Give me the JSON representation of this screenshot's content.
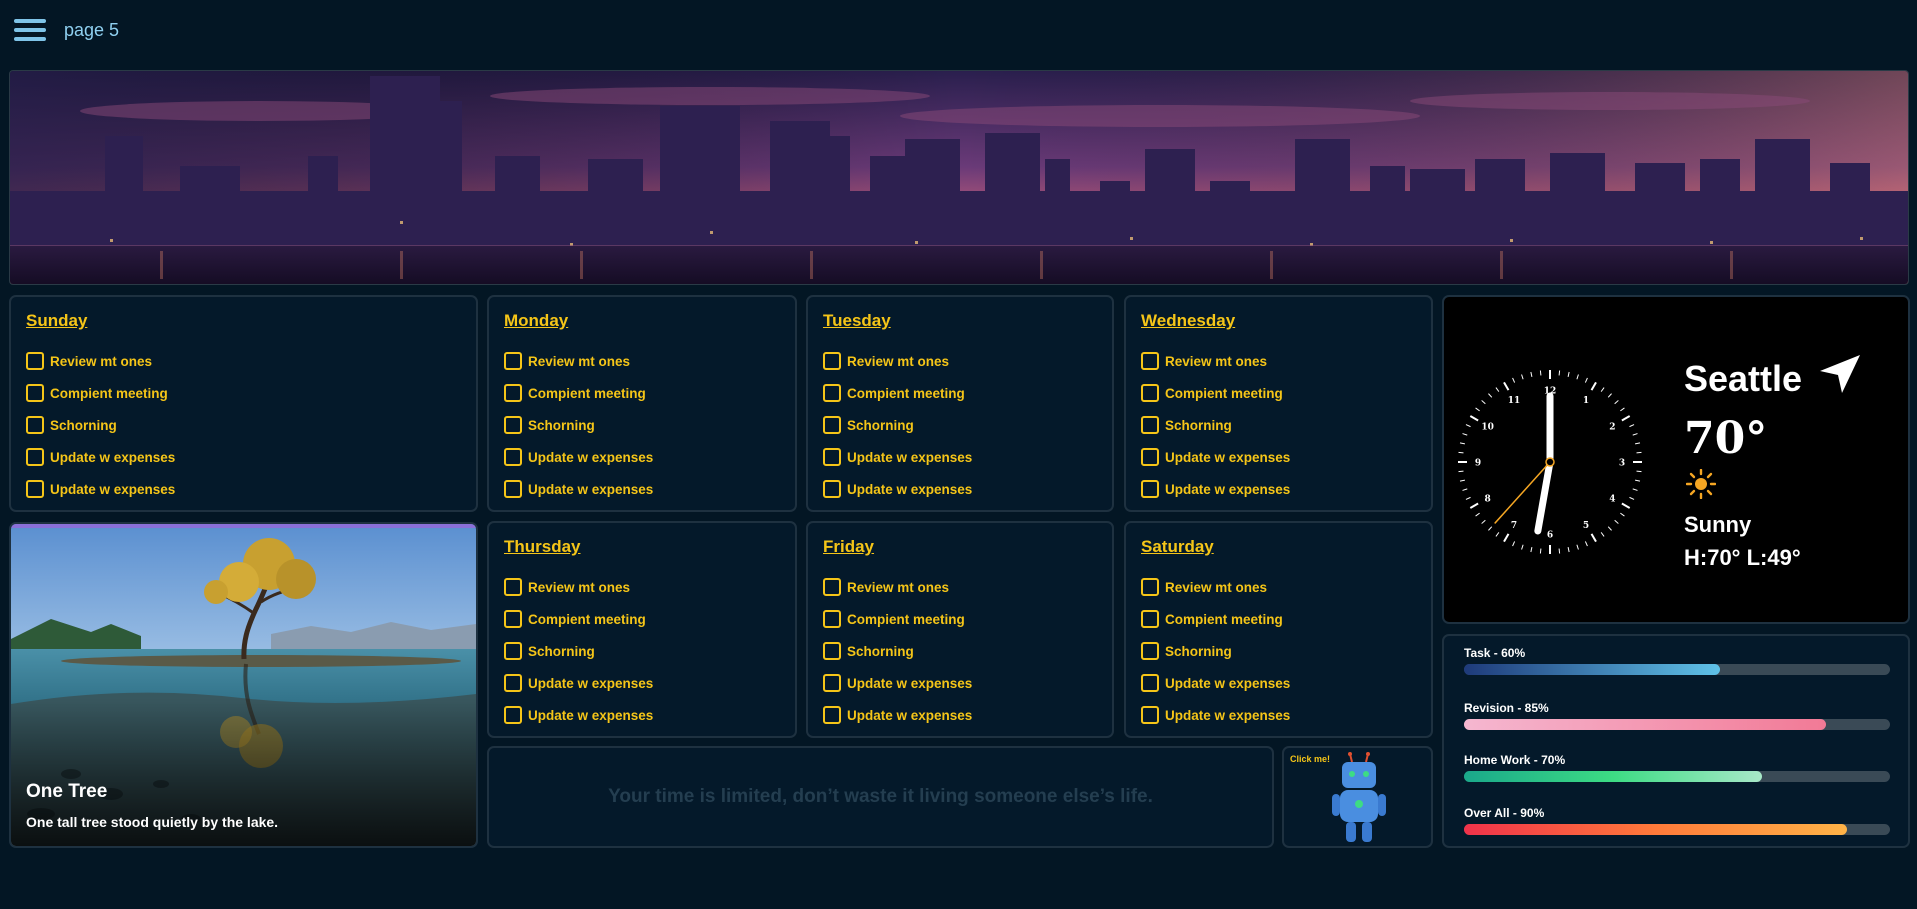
{
  "header": {
    "page_title": "page 5"
  },
  "days": [
    {
      "name": "Sunday",
      "tasks": [
        "Review mt ones",
        "Compient meeting",
        "Schorning",
        "Update w expenses",
        "Update w expenses"
      ]
    },
    {
      "name": "Monday",
      "tasks": [
        "Review mt ones",
        "Compient meeting",
        "Schorning",
        "Update w expenses",
        "Update w expenses"
      ]
    },
    {
      "name": "Tuesday",
      "tasks": [
        "Review mt ones",
        "Compient meeting",
        "Schorning",
        "Update w expenses",
        "Update w expenses"
      ]
    },
    {
      "name": "Wednesday",
      "tasks": [
        "Review mt ones",
        "Compient meeting",
        "Schorning",
        "Update w expenses",
        "Update w expenses"
      ]
    },
    {
      "name": "Thursday",
      "tasks": [
        "Review mt ones",
        "Compient meeting",
        "Schorning",
        "Update w expenses",
        "Update w expenses"
      ]
    },
    {
      "name": "Friday",
      "tasks": [
        "Review mt ones",
        "Compient meeting",
        "Schorning",
        "Update w expenses",
        "Update w expenses"
      ]
    },
    {
      "name": "Saturday",
      "tasks": [
        "Review mt ones",
        "Compient meeting",
        "Schorning",
        "Update w expenses",
        "Update w expenses"
      ]
    }
  ],
  "feature": {
    "title": "One Tree",
    "description": "One tall tree stood quietly by the lake."
  },
  "quote": "Your time is limited, don’t waste it living someone else’s life.",
  "robot": {
    "label": "Click me!"
  },
  "clock": {
    "numerals": [
      "12",
      "1",
      "2",
      "3",
      "4",
      "5",
      "6",
      "7",
      "8",
      "9",
      "10",
      "11"
    ],
    "hour": 6,
    "minute": 0,
    "second": 37
  },
  "weather": {
    "city": "Seattle",
    "temperature": "70°",
    "condition": "Sunny",
    "hilo": "H:70° L:49°",
    "icon": "sun-icon",
    "location_icon": "location-arrow-icon"
  },
  "progress": [
    {
      "label": "Task - 60%",
      "value": 0.6,
      "colors": [
        "#1e3a7a",
        "#5fc2e8"
      ]
    },
    {
      "label": "Revision - 85%",
      "value": 0.85,
      "colors": [
        "#f5b7d0",
        "#f27a96"
      ]
    },
    {
      "label": "Home Work - 70%",
      "value": 0.7,
      "colors": [
        "#1aa88a",
        "#3ddc84",
        "#a8e8c8"
      ]
    },
    {
      "label": "Over All - 90%",
      "value": 0.9,
      "colors": [
        "#f0324a",
        "#ff7a3a",
        "#ffb347"
      ]
    }
  ],
  "colors": {
    "background": "#031624",
    "accent": "#f5c518",
    "card": "#04192a"
  }
}
